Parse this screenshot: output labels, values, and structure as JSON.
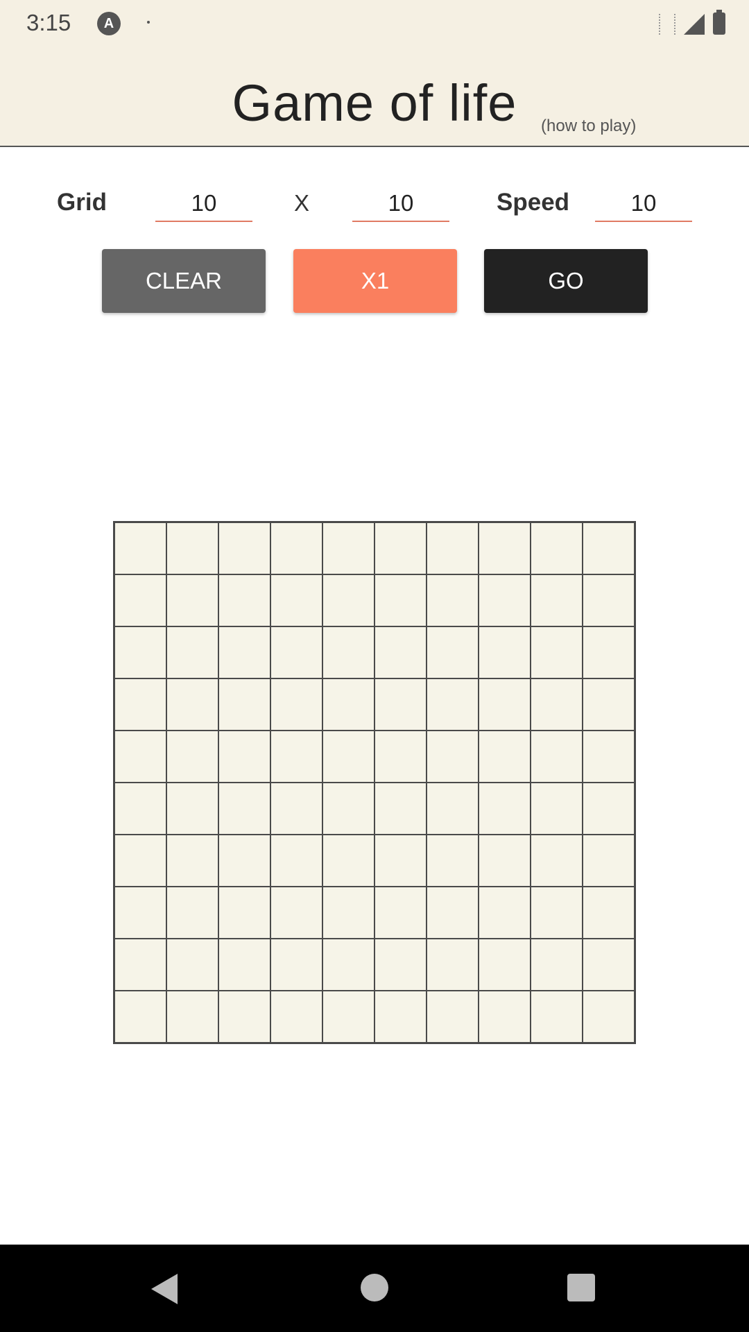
{
  "status_bar": {
    "time": "3:15",
    "app_icon_glyph": "A"
  },
  "header": {
    "title": "Game of life",
    "help_link": "(how to play)"
  },
  "settings": {
    "grid_label": "Grid",
    "cols": "10",
    "x_label": "X",
    "rows": "10",
    "speed_label": "Speed",
    "speed": "10"
  },
  "buttons": {
    "clear": "CLEAR",
    "step": "X1",
    "go": "GO"
  },
  "board": {
    "rows": 10,
    "cols": 10,
    "alive_cells": []
  },
  "colors": {
    "header_bg": "#f5f0e3",
    "accent": "#fa7f5e",
    "clear_button": "#666666",
    "go_button": "#222222",
    "cell_bg": "#f6f4e8"
  }
}
